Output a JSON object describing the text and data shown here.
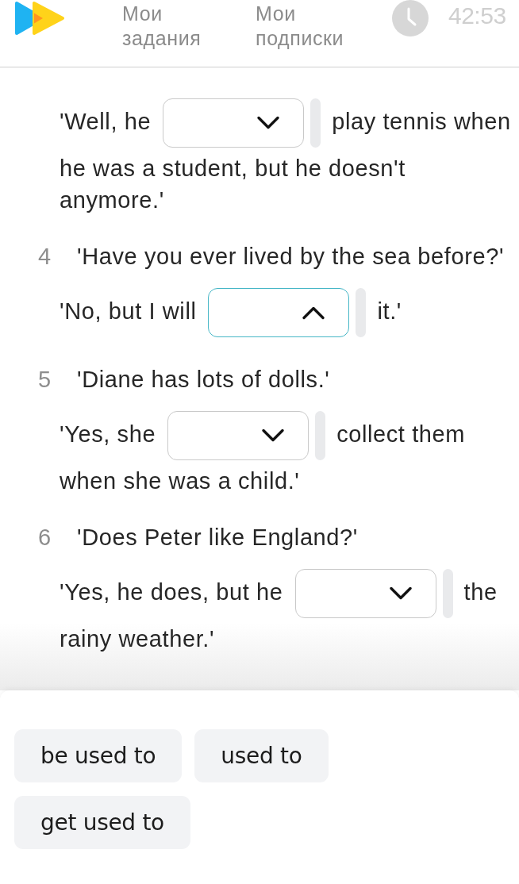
{
  "header": {
    "nav": [
      {
        "label": "Мои задания"
      },
      {
        "label": "Мои подписки"
      }
    ],
    "timer": "42:53"
  },
  "items": [
    {
      "answer": {
        "before": "'Well, he",
        "blank": {
          "expanded": false
        },
        "after": "play tennis when",
        "continued": "he was a student, but he doesn't anymore.'"
      }
    },
    {
      "number": "4",
      "question": "'Have you ever lived by the sea before?'",
      "answer": {
        "before": "'No, but I will",
        "blank": {
          "expanded": true
        },
        "after": "it.'"
      }
    },
    {
      "number": "5",
      "question": "'Diane has lots of dolls.'",
      "answer": {
        "before": "'Yes, she",
        "blank": {
          "expanded": false
        },
        "after": "collect them",
        "continued": "when she was a child.'"
      }
    },
    {
      "number": "6",
      "question": "'Does Peter like England?'",
      "answer": {
        "before": "'Yes, he does, but he",
        "blank": {
          "expanded": false
        },
        "after": "the",
        "continued": "rainy weather.'"
      }
    }
  ],
  "word_bank": [
    "be used to",
    "used to",
    "get used to"
  ]
}
